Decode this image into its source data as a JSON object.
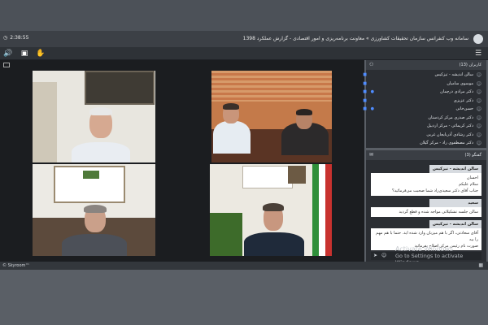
{
  "titlebar": {
    "timer": "2:38:55",
    "title": "سامانه وب کنفرانس سازمان تحقیقات کشاورزی » معاونت برنامه‌ریزی و امور اقتصادی - گزارش عملکرد 1398"
  },
  "toolbar": {
    "buttons": [
      "speaker-icon",
      "share-icon",
      "raise-hand-icon"
    ],
    "menu": "menu-icon"
  },
  "participants": {
    "header": "کاربران (13)",
    "items": [
      {
        "name": "سالن اندیشه - تیزکیس",
        "cam": true,
        "mic": false
      },
      {
        "name": "موسوی سامیان",
        "cam": true,
        "mic": false
      },
      {
        "name": "دکتر مرادی درچمان",
        "cam": true,
        "mic": true
      },
      {
        "name": "دکتر عزیزی",
        "cam": true,
        "mic": false
      },
      {
        "name": "حسن‌خانی",
        "cam": true,
        "mic": true
      },
      {
        "name": "دکتر صدری مرکز کردستان",
        "cam": false,
        "mic": false
      },
      {
        "name": "دکتر کریمائی - مرکز اردبیل",
        "cam": false,
        "mic": false
      },
      {
        "name": "دکتر رشادی آذربایجان غربی",
        "cam": false,
        "mic": false
      },
      {
        "name": "دکتر مصطفوی راد - مرکز گیلان",
        "cam": false,
        "mic": false
      }
    ]
  },
  "chat": {
    "header": "گفتگو (3)",
    "messages": [
      {
        "author": "سالن اندیشه - تیزکیس",
        "lines": [
          "احسان",
          "سلام علیکم",
          "جناب آقای دکتر سعیدی‌راد شما صحبت می‌فرمائید؟"
        ]
      },
      {
        "author": "سعید",
        "lines": [
          "سالن جلسه تشکیلاتی مواجه شده و قطع گردید"
        ]
      },
      {
        "author": "سالن اندیشه - تیزکیس",
        "lines": [
          "آقای سعادتی، اگر با هم میزبان وارد شده اید. حتما با هم مهم را بیه",
          "صورت نام رئیس مرکز اصلاح بفرمائید"
        ]
      }
    ]
  },
  "watermark": {
    "line1": "Activate Windows",
    "line2": "Go to Settings to activate Windows."
  },
  "bottombar": {
    "brand": "© Skyroom™"
  },
  "colors": {
    "accent": "#4f8cff",
    "panel": "#2b2e33",
    "titlebar": "#3c4046"
  }
}
